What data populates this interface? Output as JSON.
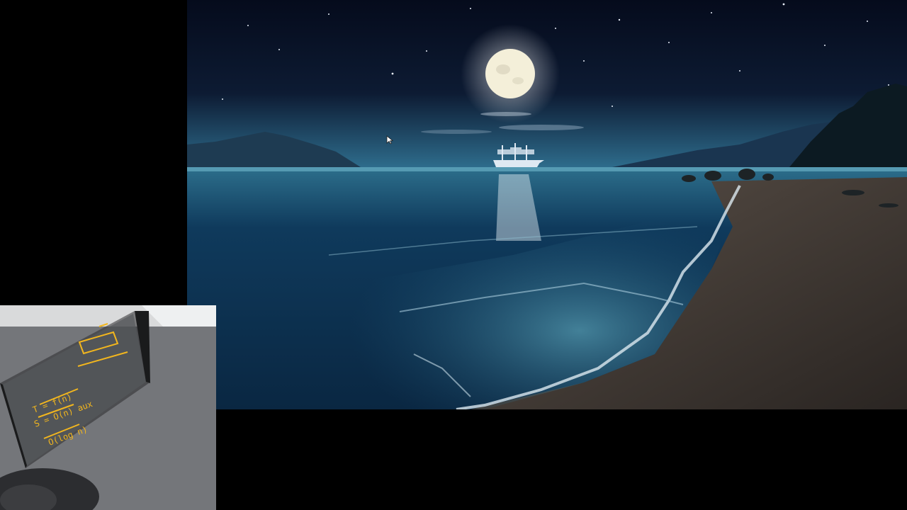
{
  "screen": {
    "background_color": "#000000",
    "desktop_wallpaper": {
      "icon": "moonlit-beach-wallpaper-icon",
      "sky_color": "#0d1b33",
      "sea_color": "#0f3a5c",
      "sand_color": "#3b3530",
      "moon_color": "#f4efd9"
    },
    "webcam_overlay": {
      "icon": "webcam-feed-icon",
      "handwriting_color": "#f2b61e",
      "handwriting_lines": [
        "T = f(n)",
        "S = O(n) aux",
        "O(log n)"
      ]
    },
    "mouse_pointer": {
      "icon": "mouse-pointer-icon"
    }
  }
}
